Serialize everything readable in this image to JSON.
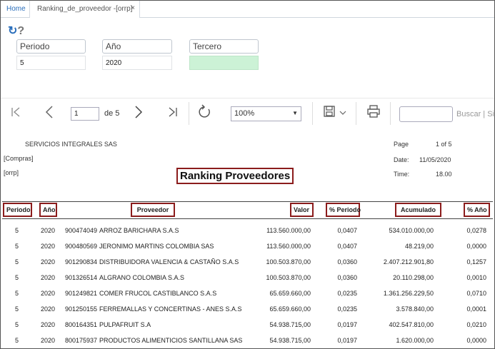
{
  "tabs": {
    "home": "Home",
    "active": "Ranking_de_proveedor -[orrp]",
    "close": "×"
  },
  "toolbar_icons": {
    "refresh": "refresh-icon",
    "help": "help-icon"
  },
  "filters": {
    "periodo": {
      "label": "Periodo",
      "value": "5"
    },
    "anio": {
      "label": "Año",
      "value": "2020"
    },
    "tercero": {
      "label": "Tercero",
      "value": ""
    }
  },
  "report_toolbar": {
    "page_input": "1",
    "page_of": "de 5",
    "zoom": "100%",
    "search_link": "Buscar | Sig"
  },
  "report": {
    "company": "SERVICIOS INTEGRALES SAS",
    "line2": "[Compras]",
    "line3": "[orrp]",
    "title": "Ranking Proveedores",
    "page_label": "Page",
    "page_value": "1 of 5",
    "date_label": "Date:",
    "date_value": "11/05/2020",
    "time_label": "Time:",
    "time_value": "18.00"
  },
  "table": {
    "headers": {
      "periodo": "Periodo",
      "anio": "Año",
      "proveedor": "Proveedor",
      "valor": "Valor",
      "pct_periodo": "% Periodo",
      "acumulado": "Acumulado",
      "pct_anio": "% Año"
    },
    "rows": [
      {
        "periodo": "5",
        "anio": "2020",
        "nit": "900474049",
        "nombre": "ARROZ BARICHARA S.A.S",
        "valor": "113.560.000,00",
        "pct_periodo": "0,0407",
        "acumulado": "534.010.000,00",
        "pct_anio": "0,0278"
      },
      {
        "periodo": "5",
        "anio": "2020",
        "nit": "900480569",
        "nombre": "JERONIMO MARTINS COLOMBIA SAS",
        "valor": "113.560.000,00",
        "pct_periodo": "0,0407",
        "acumulado": "48.219,00",
        "pct_anio": "0,0000"
      },
      {
        "periodo": "5",
        "anio": "2020",
        "nit": "901290834",
        "nombre": "DISTRIBUIDORA VALENCIA & CASTAÑO S.A.S",
        "valor": "100.503.870,00",
        "pct_periodo": "0,0360",
        "acumulado": "2.407.212.901,80",
        "pct_anio": "0,1257"
      },
      {
        "periodo": "5",
        "anio": "2020",
        "nit": "901326514",
        "nombre": "ALGRANO COLOMBIA S.A.S",
        "valor": "100.503.870,00",
        "pct_periodo": "0,0360",
        "acumulado": "20.110.298,00",
        "pct_anio": "0,0010"
      },
      {
        "periodo": "5",
        "anio": "2020",
        "nit": "901249821",
        "nombre": "COMER FRUCOL CASTIBLANCO S.A.S",
        "valor": "65.659.660,00",
        "pct_periodo": "0,0235",
        "acumulado": "1.361.256.229,50",
        "pct_anio": "0,0710"
      },
      {
        "periodo": "5",
        "anio": "2020",
        "nit": "901250155",
        "nombre": "FERREMALLAS Y CONCERTINAS - ANES S.A.S",
        "valor": "65.659.660,00",
        "pct_periodo": "0,0235",
        "acumulado": "3.578.840,00",
        "pct_anio": "0,0001"
      },
      {
        "periodo": "5",
        "anio": "2020",
        "nit": "800164351",
        "nombre": "PULPAFRUIT S.A",
        "valor": "54.938.715,00",
        "pct_periodo": "0,0197",
        "acumulado": "402.547.810,00",
        "pct_anio": "0,0210"
      },
      {
        "periodo": "5",
        "anio": "2020",
        "nit": "800175937",
        "nombre": "PRODUCTOS ALIMENTICIOS SANTILLANA SAS",
        "valor": "54.938.715,00",
        "pct_periodo": "0,0197",
        "acumulado": "1.620.000,00",
        "pct_anio": "0,0000"
      }
    ]
  }
}
